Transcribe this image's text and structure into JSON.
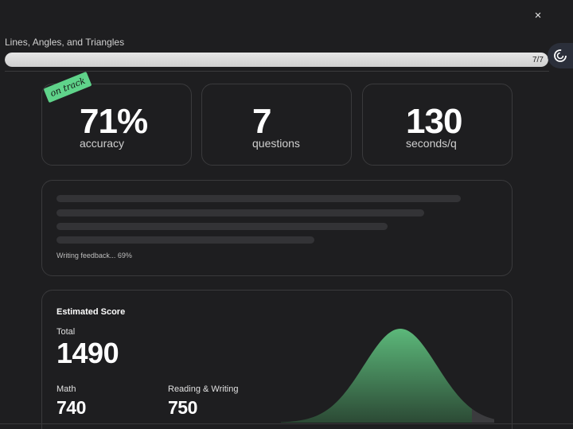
{
  "header": {
    "close_label": "×",
    "topic_title": "Lines, Angles, and Triangles",
    "progress": {
      "count_label": "7/7",
      "fraction": 1.0
    }
  },
  "icons": {
    "close": "close-icon",
    "side_button": "spiral-icon"
  },
  "badge": {
    "label": "on track",
    "color": "#5fd38a"
  },
  "stats": [
    {
      "value": "71%",
      "label": "accuracy"
    },
    {
      "value": "7",
      "label": "questions"
    },
    {
      "value": "130",
      "label": "seconds/q"
    }
  ],
  "feedback": {
    "status_text": "Writing feedback... 69%"
  },
  "estimated_score": {
    "heading": "Estimated Score",
    "total_label": "Total",
    "total_value": "1490",
    "math_label": "Math",
    "math_value": "740",
    "rw_label": "Reading & Writing",
    "rw_value": "750",
    "curve_color": "#5cb87a"
  },
  "colors": {
    "background": "#1e1e20",
    "card_border": "#3a3a3c",
    "accent_green": "#5fd38a"
  }
}
